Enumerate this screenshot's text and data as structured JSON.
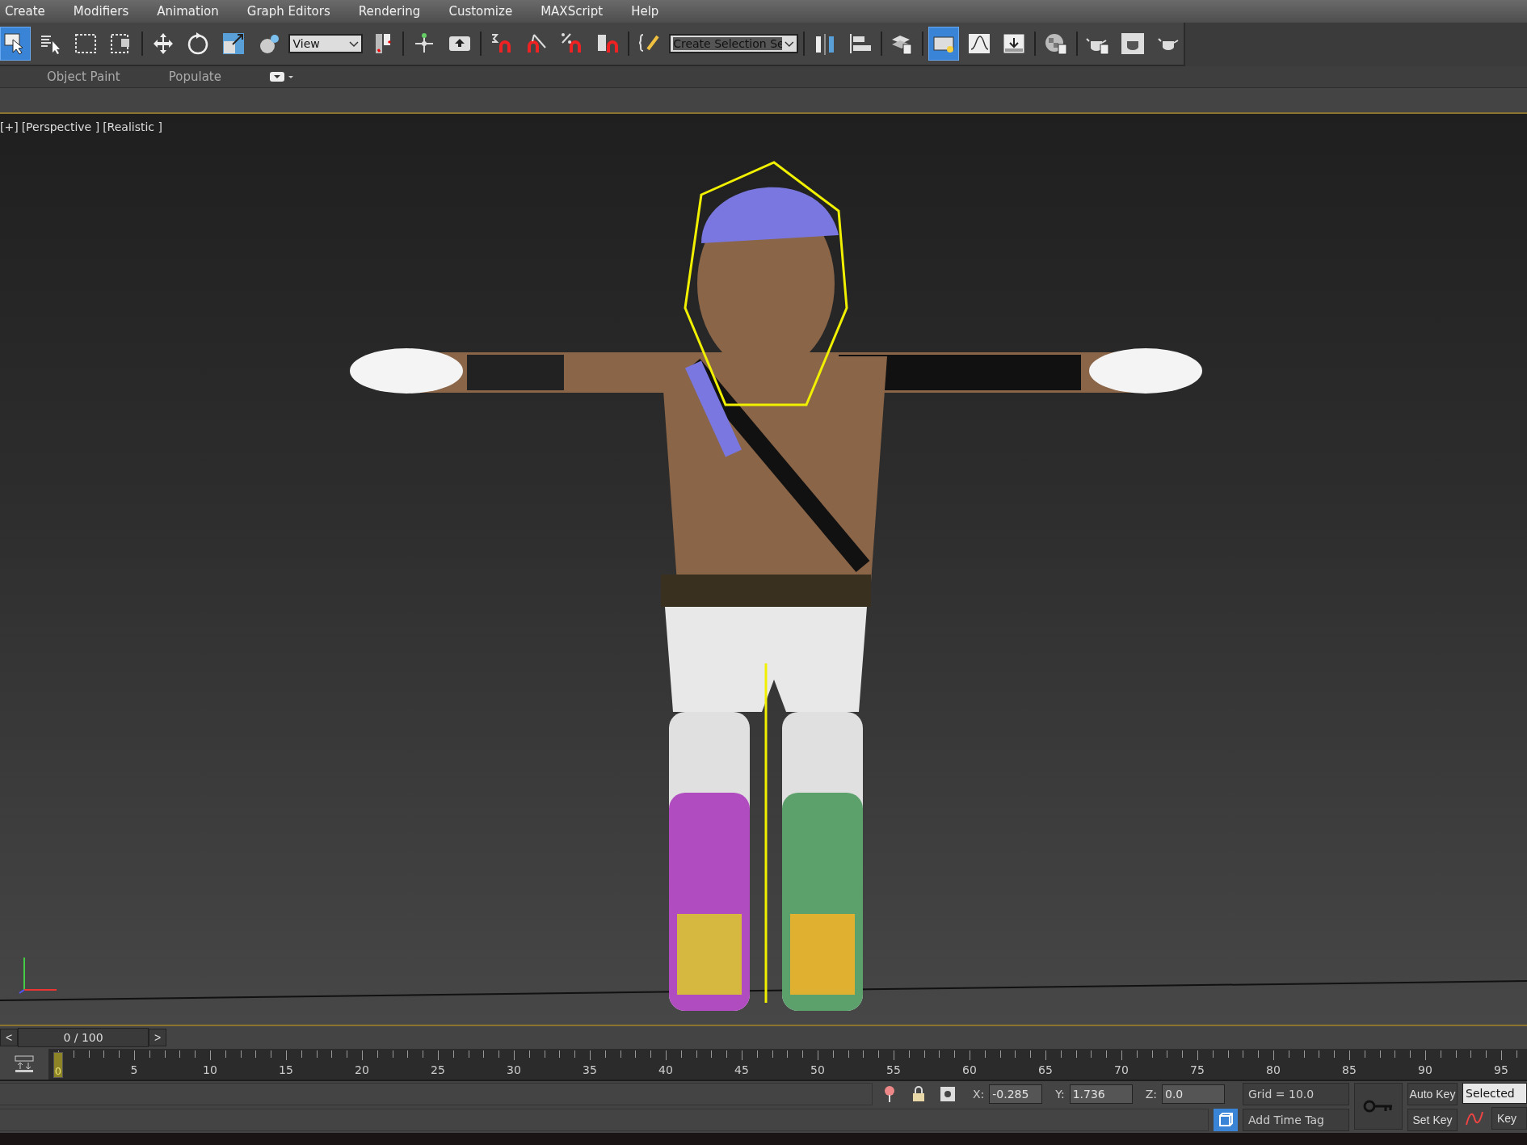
{
  "menu": [
    "Create",
    "Modifiers",
    "Animation",
    "Graph Editors",
    "Rendering",
    "Customize",
    "MAXScript",
    "Help"
  ],
  "toolbar": [
    {
      "kind": "button",
      "selected": true
    },
    {
      "kind": "button",
      "selected": false
    },
    {
      "kind": "button",
      "selected": false
    },
    {
      "kind": "button",
      "selected": false
    },
    {
      "kind": "separator"
    },
    {
      "kind": "button",
      "selected": false
    },
    {
      "kind": "button",
      "selected": false
    },
    {
      "kind": "button",
      "selected": false
    },
    {
      "kind": "button",
      "selected": false
    },
    {
      "kind": "dropdown",
      "value": "View"
    },
    {
      "kind": "button",
      "selected": false
    },
    {
      "kind": "separator"
    },
    {
      "kind": "button",
      "selected": false
    },
    {
      "kind": "button",
      "selected": false
    },
    {
      "kind": "separator"
    },
    {
      "kind": "button",
      "selected": false
    },
    {
      "kind": "button",
      "selected": false
    },
    {
      "kind": "button",
      "selected": false
    },
    {
      "kind": "button",
      "selected": false
    },
    {
      "kind": "separator"
    },
    {
      "kind": "button",
      "selected": false
    },
    {
      "kind": "dropdown",
      "value": "Create Selection Se"
    },
    {
      "kind": "separator"
    },
    {
      "kind": "button",
      "selected": false
    },
    {
      "kind": "button",
      "selected": false
    },
    {
      "kind": "separator"
    },
    {
      "kind": "button",
      "selected": false
    },
    {
      "kind": "separator"
    },
    {
      "kind": "button",
      "selected": true
    },
    {
      "kind": "button",
      "selected": false
    },
    {
      "kind": "button",
      "selected": false
    },
    {
      "kind": "separator"
    },
    {
      "kind": "button",
      "selected": false
    },
    {
      "kind": "separator"
    },
    {
      "kind": "button",
      "selected": false
    },
    {
      "kind": "button",
      "selected": false
    },
    {
      "kind": "button",
      "selected": false
    }
  ],
  "ribbon": {
    "tabs": [
      "Object Paint",
      "Populate"
    ]
  },
  "viewport": {
    "labels": [
      "[+]",
      "[Perspective ]",
      "[Realistic ]"
    ]
  },
  "time_slider": {
    "prev": "<",
    "position": "0 / 100",
    "next": ">"
  },
  "track": {
    "current": "0",
    "ticks": [
      "5",
      "10",
      "15",
      "20",
      "25",
      "30",
      "35",
      "40",
      "45",
      "50",
      "55",
      "60",
      "65",
      "70",
      "75",
      "80",
      "85",
      "90",
      "95"
    ]
  },
  "status": {
    "coords": [
      {
        "axis": "X:",
        "value": "-0.285"
      },
      {
        "axis": "Y:",
        "value": "1.736"
      },
      {
        "axis": "Z:",
        "value": "0.0"
      }
    ],
    "grid": "Grid = 10.0",
    "time_tag": "Add Time Tag"
  },
  "keys": {
    "auto_key": "Auto Key",
    "set_key": "Set Key",
    "key_filter": "Selected",
    "key_button": "Key"
  }
}
